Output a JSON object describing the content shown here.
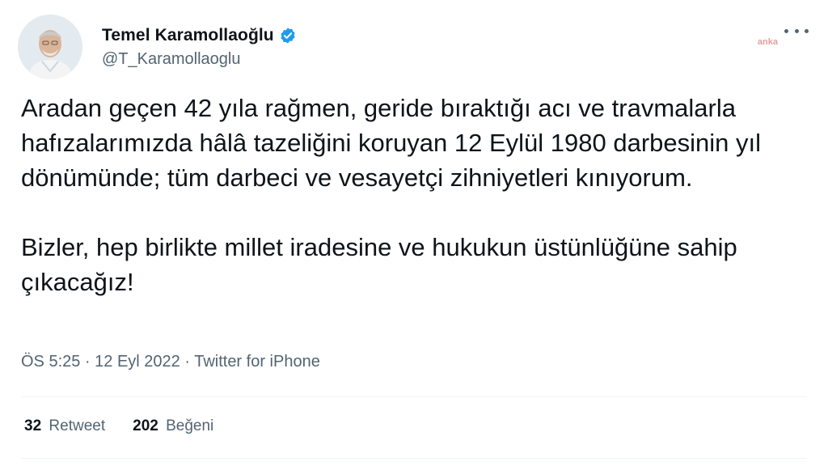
{
  "user": {
    "display_name": "Temel Karamollaoğlu",
    "handle": "@T_Karamollaoglu",
    "avatar_icon": "profile-photo",
    "verified_icon": "verified-badge-icon",
    "verified_color": "#1d9bf0"
  },
  "watermark": {
    "text": "anka"
  },
  "tweet": {
    "paragraphs": [
      "Aradan geçen 42 yıla rağmen, geride bıraktığı acı ve travmalarla hafızalarımızda hâlâ tazeliğini koruyan 12 Eylül 1980 darbesinin yıl dönümünde; tüm darbeci ve vesayetçi zihniyetleri kınıyorum.",
      "Bizler, hep birlikte millet iradesine ve hukukun üstünlüğüne sahip çıkacağız!"
    ],
    "meta": "ÖS 5:25 · 12 Eyl 2022 · Twitter for iPhone"
  },
  "stats": {
    "retweets_count": "32",
    "retweets_label": "Retweet",
    "likes_count": "202",
    "likes_label": "Beğeni"
  },
  "colors": {
    "text": "#0f1419",
    "secondary": "#536471",
    "divider": "#eff3f4"
  }
}
